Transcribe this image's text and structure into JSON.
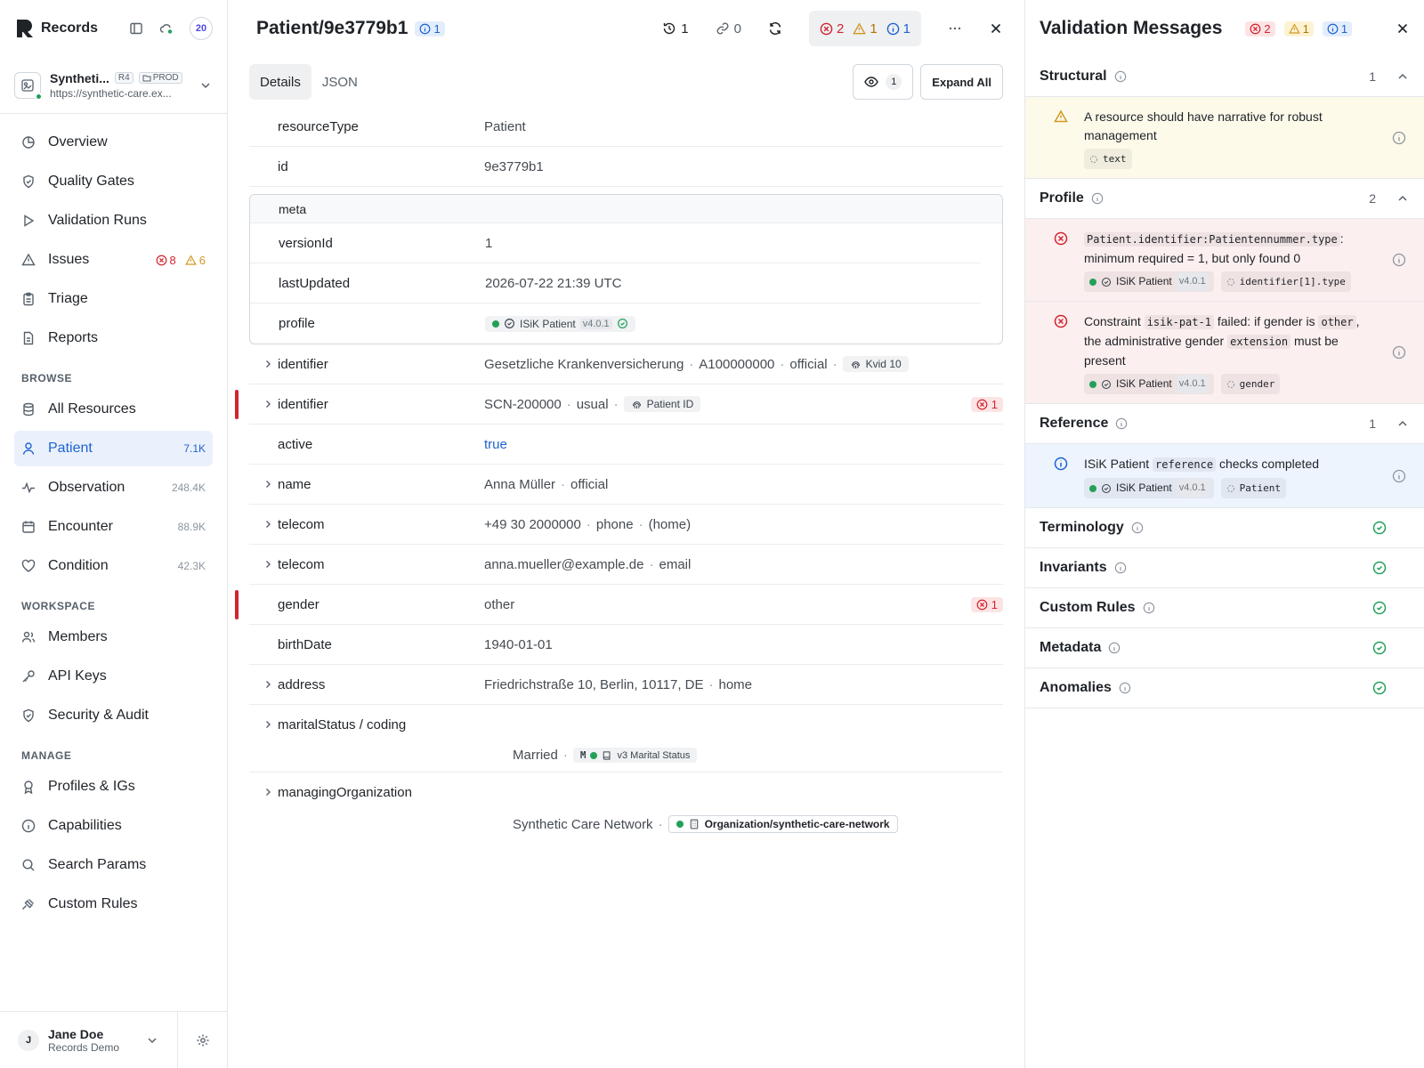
{
  "sidebar": {
    "app_name": "Records",
    "notification_count": "20",
    "workspace": {
      "name": "Syntheti...",
      "version_tag": "R4",
      "env_tag": "PROD",
      "url": "https://synthetic-care.ex..."
    },
    "nav": [
      {
        "label": "Overview",
        "icon": "overview-icon"
      },
      {
        "label": "Quality Gates",
        "icon": "shield-icon"
      },
      {
        "label": "Validation Runs",
        "icon": "play-icon"
      },
      {
        "label": "Issues",
        "icon": "alert-icon",
        "errors": "8",
        "warnings": "6"
      },
      {
        "label": "Triage",
        "icon": "clipboard-icon"
      },
      {
        "label": "Reports",
        "icon": "document-icon"
      }
    ],
    "browse_label": "BROWSE",
    "browse": [
      {
        "label": "All Resources",
        "count": ""
      },
      {
        "label": "Patient",
        "count": "7.1K"
      },
      {
        "label": "Observation",
        "count": "248.4K"
      },
      {
        "label": "Encounter",
        "count": "88.9K"
      },
      {
        "label": "Condition",
        "count": "42.3K"
      }
    ],
    "workspace_label": "WORKSPACE",
    "workspace_items": [
      {
        "label": "Members"
      },
      {
        "label": "API Keys"
      },
      {
        "label": "Security & Audit"
      }
    ],
    "manage_label": "MANAGE",
    "manage_items": [
      {
        "label": "Profiles & IGs"
      },
      {
        "label": "Capabilities"
      },
      {
        "label": "Search Params"
      },
      {
        "label": "Custom Rules"
      }
    ],
    "user": {
      "initial": "J",
      "name": "Jane Doe",
      "subtitle": "Records Demo"
    }
  },
  "main": {
    "title": "Patient/9e3779b1",
    "title_info_count": "1",
    "history_count": "1",
    "links_count": "0",
    "summary": {
      "errors": "2",
      "warnings": "1",
      "info": "1"
    },
    "tabs": [
      {
        "label": "Details"
      },
      {
        "label": "JSON"
      }
    ],
    "view_count": "1",
    "expand_all_label": "Expand All",
    "fields": {
      "resourceType": {
        "key": "resourceType",
        "value": "Patient"
      },
      "id": {
        "key": "id",
        "value": "9e3779b1"
      },
      "meta": {
        "label": "meta",
        "versionId": {
          "key": "versionId",
          "value": "1"
        },
        "lastUpdated": {
          "key": "lastUpdated",
          "value": "2026-07-22 21:39 UTC"
        },
        "profile": {
          "key": "profile",
          "name": "ISiK Patient",
          "version": "v4.0.1"
        }
      },
      "identifier1": {
        "key": "identifier",
        "system": "Gesetzliche Krankenversicherung",
        "value": "A100000000",
        "use": "official",
        "chip": "Kvid 10"
      },
      "identifier2": {
        "key": "identifier",
        "value": "SCN-200000",
        "use": "usual",
        "chip": "Patient ID",
        "errors": "1"
      },
      "active": {
        "key": "active",
        "value": "true"
      },
      "name": {
        "key": "name",
        "value": "Anna Müller",
        "use": "official"
      },
      "telecom1": {
        "key": "telecom",
        "value": "+49 30 2000000",
        "system": "phone",
        "use": "(home)"
      },
      "telecom2": {
        "key": "telecom",
        "value": "anna.mueller@example.de",
        "system": "email"
      },
      "gender": {
        "key": "gender",
        "value": "other",
        "errors": "1"
      },
      "birthDate": {
        "key": "birthDate",
        "value": "1940-01-01"
      },
      "address": {
        "key": "address",
        "value": "Friedrichstraße 10, Berlin, 10117, DE",
        "use": "home"
      },
      "maritalStatus": {
        "key": "maritalStatus / coding",
        "display": "Married",
        "code": "M",
        "system": "v3 Marital Status"
      },
      "managingOrganization": {
        "key": "managingOrganization",
        "display": "Synthetic Care Network",
        "reference": "Organization/synthetic-care-network"
      }
    }
  },
  "panel": {
    "title": "Validation Messages",
    "counts": {
      "errors": "2",
      "warnings": "1",
      "info": "1"
    },
    "groups": {
      "structural": {
        "label": "Structural",
        "count": "1"
      },
      "profile": {
        "label": "Profile",
        "count": "2"
      },
      "reference": {
        "label": "Reference",
        "count": "1"
      },
      "terminology": {
        "label": "Terminology"
      },
      "invariants": {
        "label": "Invariants"
      },
      "custom_rules": {
        "label": "Custom Rules"
      },
      "metadata": {
        "label": "Metadata"
      },
      "anomalies": {
        "label": "Anomalies"
      }
    },
    "messages": {
      "m1": {
        "text": "A resource should have narrative for robust management",
        "path": "text"
      },
      "m2": {
        "code": "Patient.identifier:Patientennummer.type",
        "text": ": minimum required = 1, but only found 0",
        "profile": "ISiK Patient",
        "version": "v4.0.1",
        "path": "identifier[1].type"
      },
      "m3": {
        "pre": "Constraint ",
        "code": "isik-pat-1",
        "mid": " failed: if gender is ",
        "code2": "other",
        "mid2": ", the administrative gender ",
        "code3": "extension",
        "post": " must be present",
        "profile": "ISiK Patient",
        "version": "v4.0.1",
        "path": "gender"
      },
      "m4": {
        "pre": "ISiK Patient ",
        "code": "reference",
        "post": " checks completed",
        "profile": "ISiK Patient",
        "version": "v4.0.1",
        "path": "Patient"
      }
    }
  },
  "colors": {
    "accent": "#1e62d0",
    "error": "#d1242f",
    "warning": "#d29922",
    "success": "#22a05a"
  }
}
